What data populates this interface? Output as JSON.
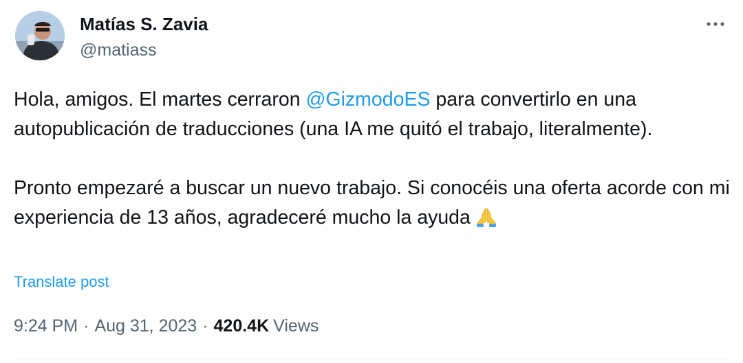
{
  "author": {
    "display_name": "Matías S. Zavia",
    "handle": "@matiass"
  },
  "more_icon": "more-horizontal-icon",
  "post": {
    "paragraph1_before": "Hola, amigos. El martes cerraron ",
    "mention": "@GizmodoES",
    "paragraph1_after": " para convertirlo en una autopublicación de traducciones (una IA me quitó el trabajo, literalmente).",
    "paragraph2": "Pronto empezaré a buscar un nuevo trabajo. Si conocéis una oferta acorde con mi experiencia de 13 años, agradeceré mucho la ayuda",
    "emoji": "folded-hands-emoji"
  },
  "translate_label": "Translate post",
  "meta": {
    "time": "9:24 PM",
    "separator": "·",
    "date": "Aug 31, 2023",
    "views_count": "420.4K",
    "views_label": "Views"
  },
  "colors": {
    "link": "#1d9bf0",
    "secondary_text": "#536471",
    "primary_text": "#0f1419"
  }
}
